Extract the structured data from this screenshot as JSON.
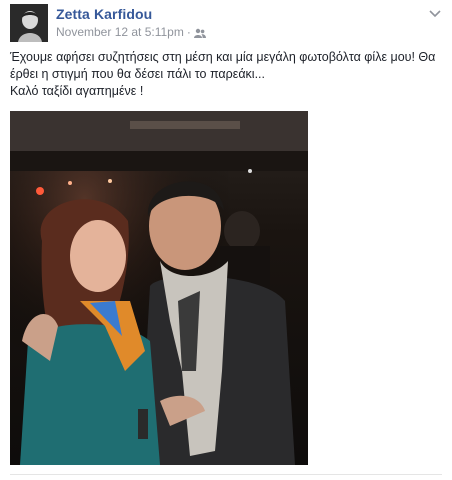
{
  "post": {
    "author": "Zetta Karfidou",
    "timestamp": "November 12 at 5:11pm",
    "separator": "·",
    "audience_icon": "friends-icon",
    "menu_icon": "chevron-down-icon",
    "text_lines": [
      "Έχουμε αφήσει συζητήσεις στη μέση και μία μεγάλη φωτοβόλτα φίλε μου! Θα έρθει η στιγμή που θα δέσει πάλι το παρεάκι...",
      "Καλό ταξίδι αγαπημένε !"
    ],
    "photo": "photo of a smiling woman and man embracing at an evening gathering"
  },
  "colors": {
    "author_link": "#365899",
    "meta_text": "#90949c",
    "body_text": "#1d2129"
  }
}
